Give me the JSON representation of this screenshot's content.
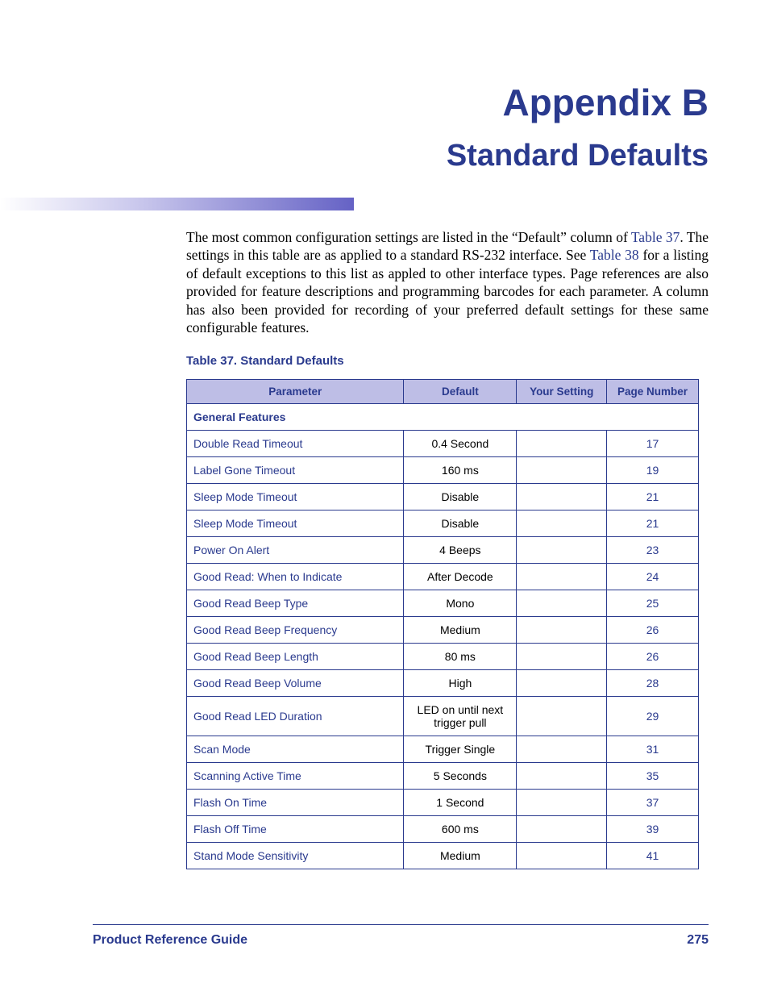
{
  "title": "Appendix B",
  "subtitle": "Standard Defaults",
  "intro": {
    "part1": "The most common configuration settings are listed in the “Default” column of ",
    "link1": "Table 37",
    "part2": ". The settings in this table are as applied to a standard RS-232 interface. See ",
    "link2": "Table 38",
    "part3": " for a listing of default exceptions to this list as appled to other interface types. Page references are also provided for feature descriptions and programming barcodes for each parameter. A column has also been provided for recording of your preferred default settings for these same configurable features."
  },
  "table_caption": "Table 37. Standard Defaults",
  "columns": {
    "parameter": "Parameter",
    "default": "Default",
    "your_setting": "Your Setting",
    "page_number": "Page Number"
  },
  "section": "General Features",
  "rows": [
    {
      "parameter": "Double Read Timeout",
      "default": "0.4 Second",
      "setting": "",
      "page": "17"
    },
    {
      "parameter": "Label Gone Timeout",
      "default": "160 ms",
      "setting": "",
      "page": "19"
    },
    {
      "parameter": "Sleep Mode Timeout",
      "default": "Disable",
      "setting": "",
      "page": "21"
    },
    {
      "parameter": "Sleep Mode Timeout",
      "default": "Disable",
      "setting": "",
      "page": "21"
    },
    {
      "parameter": "Power On Alert",
      "default": "4 Beeps",
      "setting": "",
      "page": "23"
    },
    {
      "parameter": "Good Read: When to Indicate",
      "default": "After Decode",
      "setting": "",
      "page": "24"
    },
    {
      "parameter": "Good Read Beep Type",
      "default": "Mono",
      "setting": "",
      "page": "25"
    },
    {
      "parameter": "Good Read Beep Frequency",
      "default": "Medium",
      "setting": "",
      "page": "26"
    },
    {
      "parameter": "Good Read Beep Length",
      "default": "80 ms",
      "setting": "",
      "page": "26"
    },
    {
      "parameter": "Good Read Beep Volume",
      "default": "High",
      "setting": "",
      "page": "28"
    },
    {
      "parameter": "Good Read LED Duration",
      "default": "LED on until next trigger pull",
      "setting": "",
      "page": "29"
    },
    {
      "parameter": "Scan Mode",
      "default": "Trigger Single",
      "setting": "",
      "page": "31"
    },
    {
      "parameter": "Scanning Active Time",
      "default": "5 Seconds",
      "setting": "",
      "page": "35"
    },
    {
      "parameter": "Flash On Time",
      "default": "1 Second",
      "setting": "",
      "page": "37"
    },
    {
      "parameter": "Flash Off Time",
      "default": "600 ms",
      "setting": "",
      "page": "39"
    },
    {
      "parameter": "Stand Mode Sensitivity",
      "default": "Medium",
      "setting": "",
      "page": "41"
    }
  ],
  "footer": {
    "left": "Product Reference Guide",
    "right": "275"
  }
}
